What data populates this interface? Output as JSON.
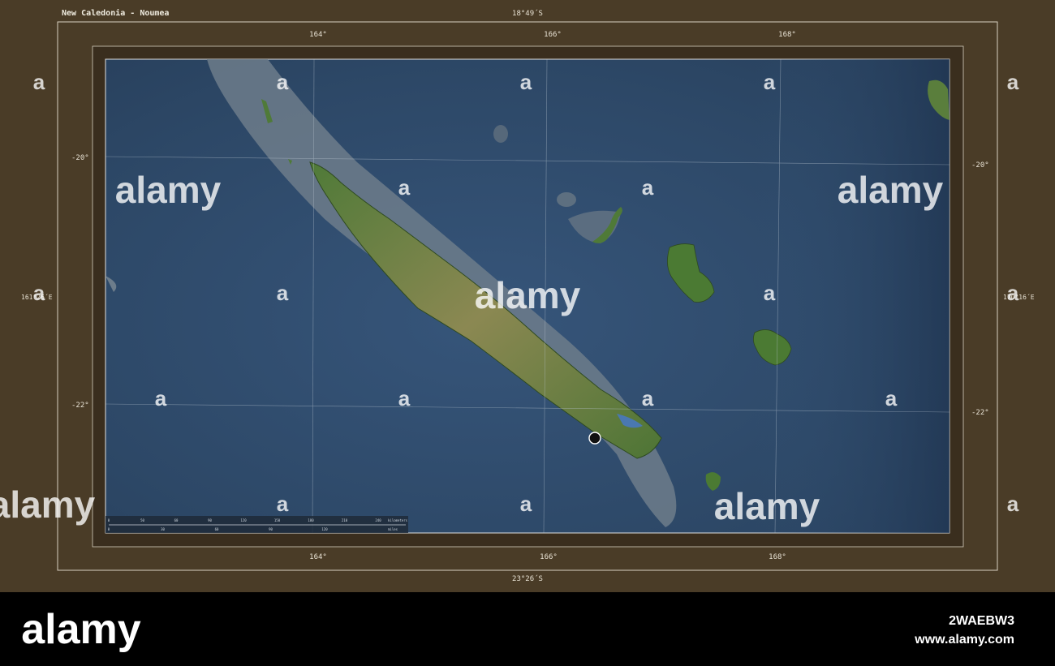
{
  "map": {
    "title": "New Caledonia - Noumea",
    "bounds": {
      "top": "18°49´S",
      "bottom": "23°26´S",
      "left": "161°26´E",
      "right": "170°16´E"
    },
    "longitude_ticks_top": [
      "164°",
      "166°",
      "168°"
    ],
    "longitude_ticks_bottom": [
      "164°",
      "166°",
      "168°"
    ],
    "latitude_ticks_left": [
      "-20°",
      "-22°"
    ],
    "latitude_ticks_right": [
      "-20°",
      "-22°"
    ],
    "capital_marker": "capital-dot",
    "scale_bar": {
      "km_ticks": [
        "0",
        "50",
        "60",
        "90",
        "120",
        "150",
        "180",
        "210",
        "240"
      ],
      "km_unit": "kilometers",
      "mi_ticks": [
        "0",
        "30",
        "60",
        "90",
        "120"
      ],
      "mi_unit": "miles"
    },
    "colors": {
      "frame": "#4a3c27",
      "ocean": "#2d4867",
      "shallow": "#6d7d8b",
      "land": "#5a7e3c",
      "highland": "#8b8852"
    }
  },
  "watermarks": {
    "brand": "alamy",
    "small_glyph": "a",
    "footer_brand": "alamy",
    "footer_id": "2WAEBW3",
    "footer_url": "www.alamy.com"
  }
}
